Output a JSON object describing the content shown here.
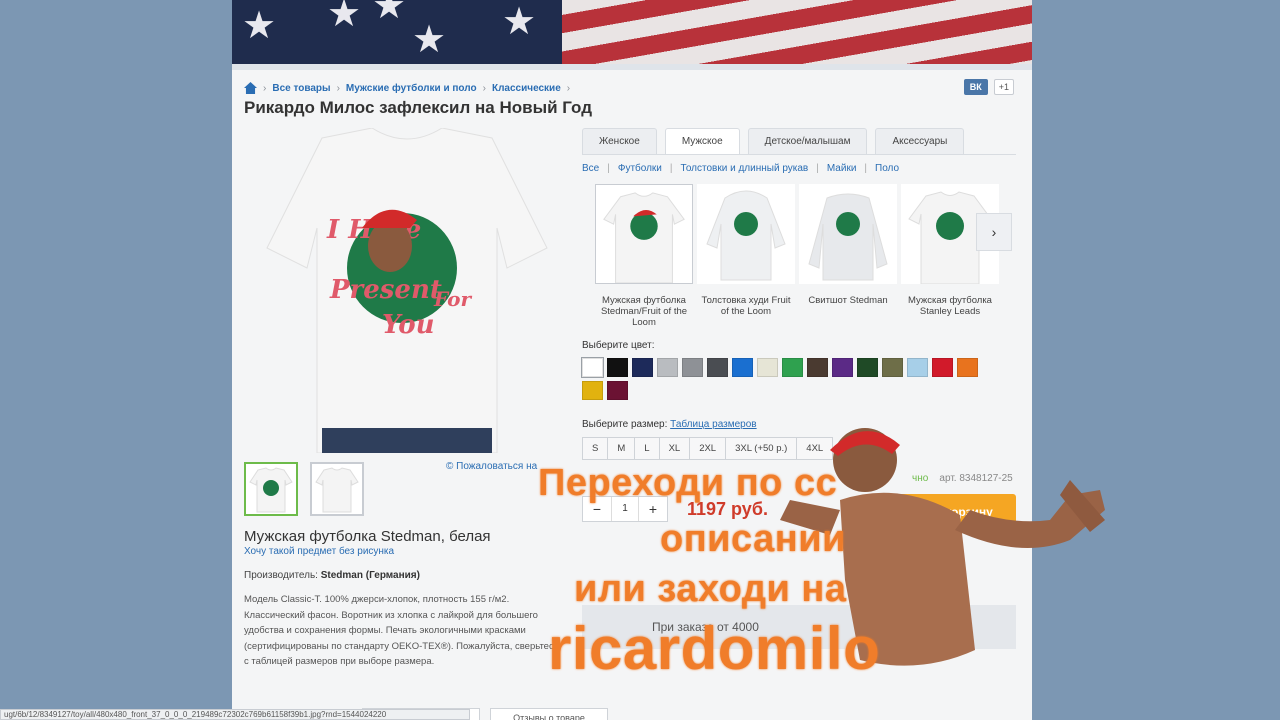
{
  "breadcrumb": {
    "items": [
      "Все товары",
      "Мужские футболки и поло",
      "Классические"
    ]
  },
  "social": {
    "vk": "ВК",
    "plus": "+1"
  },
  "product": {
    "title": "Рикардо Милос зафлексил на Новый Год",
    "name": "Мужская футболка Stedman, белая",
    "no_print_link": "Хочу такой предмет без рисунка",
    "maker_label": "Производитель:",
    "maker_value": "Stedman (Германия)",
    "description": "Модель Classic-T. 100% джерси-хлопок, плотность 155 г/м2. Классический фасон. Воротник из хлопка с лайкрой для большего удобства и сохранения формы. Печать экологичными красками (сертифицированы по стандарту OEKO-TEX®). Пожалуйста, сверьтесь с таблицей размеров при выборе размера.",
    "complain": "© Пожаловаться на",
    "print_text": [
      "I Have",
      "Present",
      "For",
      "You"
    ]
  },
  "tabs": [
    "Женское",
    "Мужское",
    "Детское/малышам",
    "Аксессуары"
  ],
  "subcategories": [
    "Все",
    "Футболки",
    "Толстовки и длинный рукав",
    "Майки",
    "Поло"
  ],
  "models": [
    "Мужская футболка Stedman/Fruit of the Loom",
    "Толстовка худи Fruit of the Loom",
    "Свитшот Stedman",
    "Мужская футболка Stanley Leads"
  ],
  "colors": {
    "label": "Выберите цвет:",
    "swatches": [
      "#ffffff",
      "#111111",
      "#1d2a5a",
      "#b9bcc0",
      "#8e9196",
      "#4a4d52",
      "#1a6fd0",
      "#e6e5d6",
      "#2fa14f",
      "#4a3a30",
      "#5b2a86",
      "#1f4a26",
      "#6e6e48",
      "#a7cfe8",
      "#d11a2a",
      "#e8731e",
      "#e1b20f",
      "#6b1233"
    ]
  },
  "sizes": {
    "label": "Выберите размер:",
    "table_link": "Таблица размеров",
    "options": [
      "S",
      "M",
      "L",
      "XL",
      "2XL",
      "3XL (+50 р.)",
      "4XL"
    ]
  },
  "stock": {
    "status": "чно",
    "article": "арт. 8348127-25"
  },
  "qty": {
    "minus": "−",
    "value": "1",
    "plus": "+"
  },
  "price": "1197 руб.",
  "cart_button": "вить в корзину",
  "promo": "При заказе от 4000",
  "bottom_buttons": [
    "",
    "Отзывы о товаре"
  ],
  "statusbar": "ugt/6b/12/8349127/toy/all/480x480_front_37_0_0_0_219489c72302c769b61158f39b1.jpg?rnd=1544024220",
  "overlay": {
    "line1": "Переходи по сс",
    "line2": "описании",
    "line3": "или заходи на",
    "line4": "ricardomilo"
  },
  "accent_colors": {
    "link": "#2a6db3",
    "cart": "#f5a623",
    "price": "#cf3b2a",
    "overlay": "#f07d2a"
  }
}
